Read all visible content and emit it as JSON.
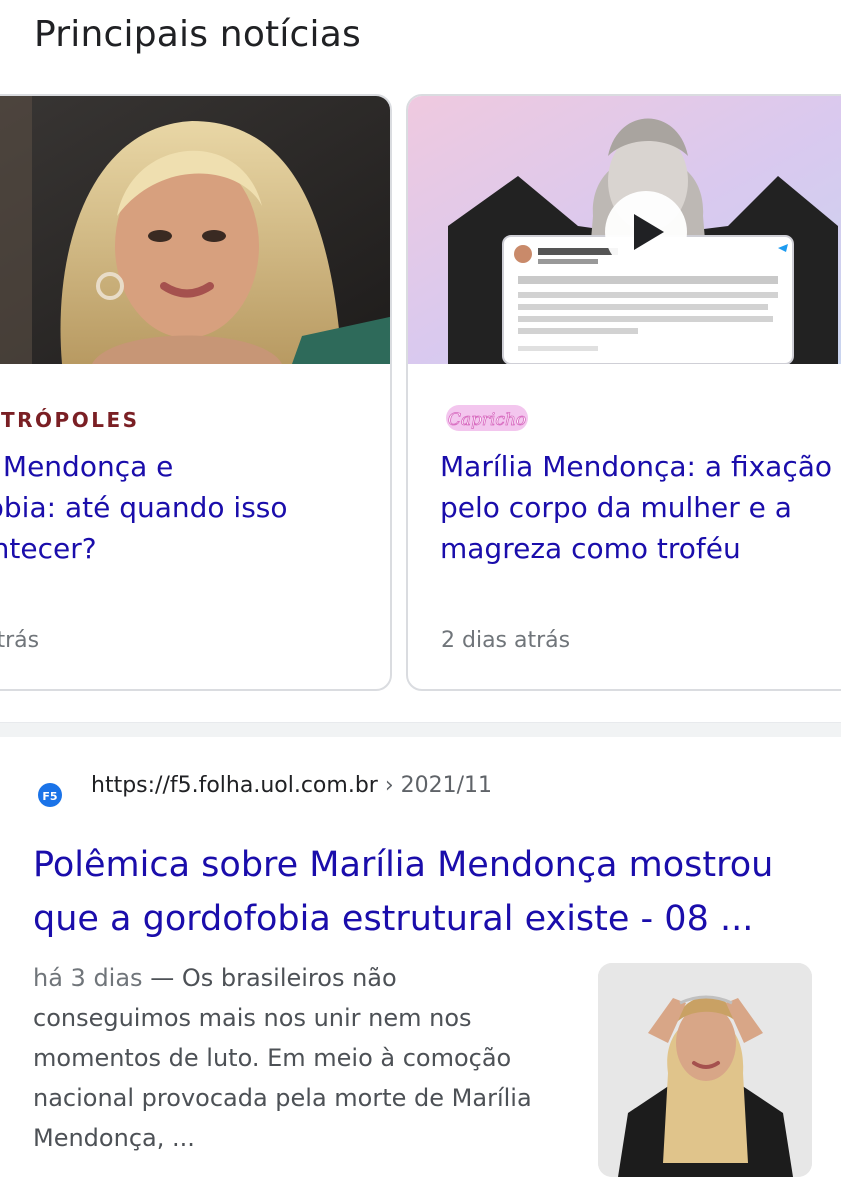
{
  "top_stories": {
    "title": "Principais notícias",
    "cards": [
      {
        "source": "TRÓPOLES",
        "headline_lines": [
          "rília Mendonça e",
          "dofobia: até quando isso",
          "acontecer?"
        ],
        "time": "ras atrás"
      },
      {
        "source_logo_icon": "capricho-logo",
        "headline_lines": [
          "Marília Mendonça: a fixação",
          "pelo corpo da mulher e a",
          "magreza como troféu"
        ],
        "time": "2 dias atrás",
        "has_video": true
      }
    ]
  },
  "result": {
    "favicon_icon": "f5-favicon",
    "url": "https://f5.folha.uol.com.br",
    "breadcrumb": " › 2021/11",
    "title_lines": [
      "Polêmica sobre Marília Mendonça mostrou",
      "que a gordofobia estrutural existe - 08 ..."
    ],
    "snippet_date": "há 3 dias",
    "snippet_lines": [
      " — Os brasileiros não",
      "conseguimos mais nos unir nem nos",
      "momentos de luto. Em meio à comoção",
      "nacional provocada pela morte de Marília",
      "Mendonça, ..."
    ]
  },
  "colors": {
    "link": "#1a0dab",
    "metropoles_red": "#7a1f24",
    "capricho_pink": "#e070c8",
    "f5_blue": "#1a73e8"
  }
}
